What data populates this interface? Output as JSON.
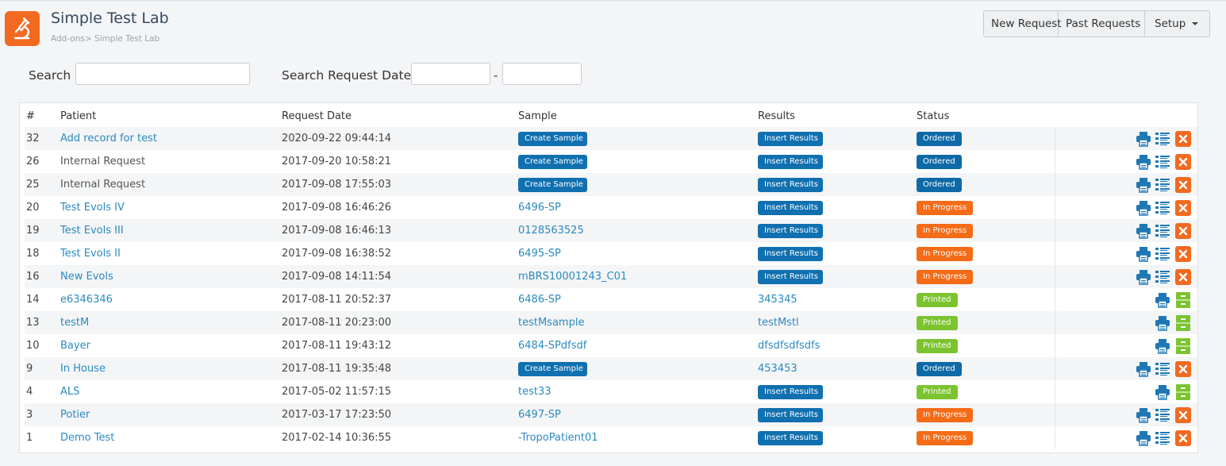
{
  "app": {
    "title": "Simple Test Lab",
    "breadcrumb": "Add-ons> Simple Test Lab"
  },
  "toolbar": {
    "new_request": "New Request",
    "past_requests": "Past Requests",
    "setup": "Setup"
  },
  "search": {
    "label": "Search",
    "value": "",
    "date_label": "Search Request Date",
    "date_from": "",
    "date_to": "",
    "date_sep": "-"
  },
  "table": {
    "headers": [
      "#",
      "Patient",
      "Request Date",
      "Sample",
      "Results",
      "Status"
    ],
    "rows": [
      {
        "id": "32",
        "patient": "Add record for test",
        "patient_link": true,
        "date": "2020-09-22 09:44:14",
        "sample": "Create Sample",
        "sample_button": true,
        "results": "Insert Results",
        "results_button": true,
        "status": "Ordered",
        "status_kind": "ordered",
        "actions": "full"
      },
      {
        "id": "26",
        "patient": "Internal Request",
        "patient_link": false,
        "date": "2017-09-20 10:58:21",
        "sample": "Create Sample",
        "sample_button": true,
        "results": "Insert Results",
        "results_button": true,
        "status": "Ordered",
        "status_kind": "ordered",
        "actions": "full"
      },
      {
        "id": "25",
        "patient": "Internal Request",
        "patient_link": false,
        "date": "2017-09-08 17:55:03",
        "sample": "Create Sample",
        "sample_button": true,
        "results": "Insert Results",
        "results_button": true,
        "status": "Ordered",
        "status_kind": "ordered",
        "actions": "full"
      },
      {
        "id": "20",
        "patient": "Test Evols IV",
        "patient_link": true,
        "date": "2017-09-08 16:46:26",
        "sample": "6496-SP",
        "sample_button": false,
        "results": "Insert Results",
        "results_button": true,
        "status": "In Progress",
        "status_kind": "progress",
        "actions": "full"
      },
      {
        "id": "19",
        "patient": "Test Evols III",
        "patient_link": true,
        "date": "2017-09-08 16:46:13",
        "sample": "0128563525",
        "sample_button": false,
        "results": "Insert Results",
        "results_button": true,
        "status": "In Progress",
        "status_kind": "progress",
        "actions": "full"
      },
      {
        "id": "18",
        "patient": "Test Evols II",
        "patient_link": true,
        "date": "2017-09-08 16:38:52",
        "sample": "6495-SP",
        "sample_button": false,
        "results": "Insert Results",
        "results_button": true,
        "status": "In Progress",
        "status_kind": "progress",
        "actions": "full"
      },
      {
        "id": "16",
        "patient": "New Evols",
        "patient_link": true,
        "date": "2017-09-08 14:11:54",
        "sample": "mBRS10001243_C01",
        "sample_button": false,
        "results": "Insert Results",
        "results_button": true,
        "status": "In Progress",
        "status_kind": "progress",
        "actions": "full"
      },
      {
        "id": "14",
        "patient": "e6346346",
        "patient_link": true,
        "date": "2017-08-11 20:52:37",
        "sample": "6486-SP",
        "sample_button": false,
        "results": "345345",
        "results_button": false,
        "status": "Printed",
        "status_kind": "printed",
        "actions": "printed"
      },
      {
        "id": "13",
        "patient": "testM",
        "patient_link": true,
        "date": "2017-08-11 20:23:00",
        "sample": "testMsample",
        "sample_button": false,
        "results": "testMstl",
        "results_button": false,
        "status": "Printed",
        "status_kind": "printed",
        "actions": "printed"
      },
      {
        "id": "10",
        "patient": "Bayer",
        "patient_link": true,
        "date": "2017-08-11 19:43:12",
        "sample": "6484-SPdfsdf",
        "sample_button": false,
        "results": "dfsdfsdfsdfs",
        "results_button": false,
        "status": "Printed",
        "status_kind": "printed",
        "actions": "printed"
      },
      {
        "id": "9",
        "patient": "In House",
        "patient_link": true,
        "date": "2017-08-11 19:35:48",
        "sample": "Create Sample",
        "sample_button": true,
        "results": "453453",
        "results_button": false,
        "status": "Ordered",
        "status_kind": "ordered",
        "actions": "full"
      },
      {
        "id": "4",
        "patient": "ALS",
        "patient_link": true,
        "date": "2017-05-02 11:57:15",
        "sample": "test33",
        "sample_button": false,
        "results": "Insert Results",
        "results_button": true,
        "status": "Printed",
        "status_kind": "printed",
        "actions": "printed"
      },
      {
        "id": "3",
        "patient": "Potier",
        "patient_link": true,
        "date": "2017-03-17 17:23:50",
        "sample": "6497-SP",
        "sample_button": false,
        "results": "Insert Results",
        "results_button": true,
        "status": "In Progress",
        "status_kind": "progress",
        "actions": "full"
      },
      {
        "id": "1",
        "patient": "Demo Test",
        "patient_link": true,
        "date": "2017-02-14 10:36:55",
        "sample": "-TropoPatient01",
        "sample_button": false,
        "results": "Insert Results",
        "results_button": true,
        "status": "In Progress",
        "status_kind": "progress",
        "actions": "full"
      }
    ]
  },
  "colors": {
    "brand": "#f26a21",
    "link": "#2b8ac0",
    "button_blue": "#1070b0",
    "status_ordered": "#0d6aa6",
    "status_progress": "#f56b17",
    "status_printed": "#7cc42f",
    "delete": "#f26a21"
  },
  "icons": {
    "logo": "microscope-icon",
    "print": "printer-icon",
    "details": "list-icon",
    "delete": "close-icon",
    "archive": "cabinet-icon",
    "setup": "caret-down-icon"
  }
}
